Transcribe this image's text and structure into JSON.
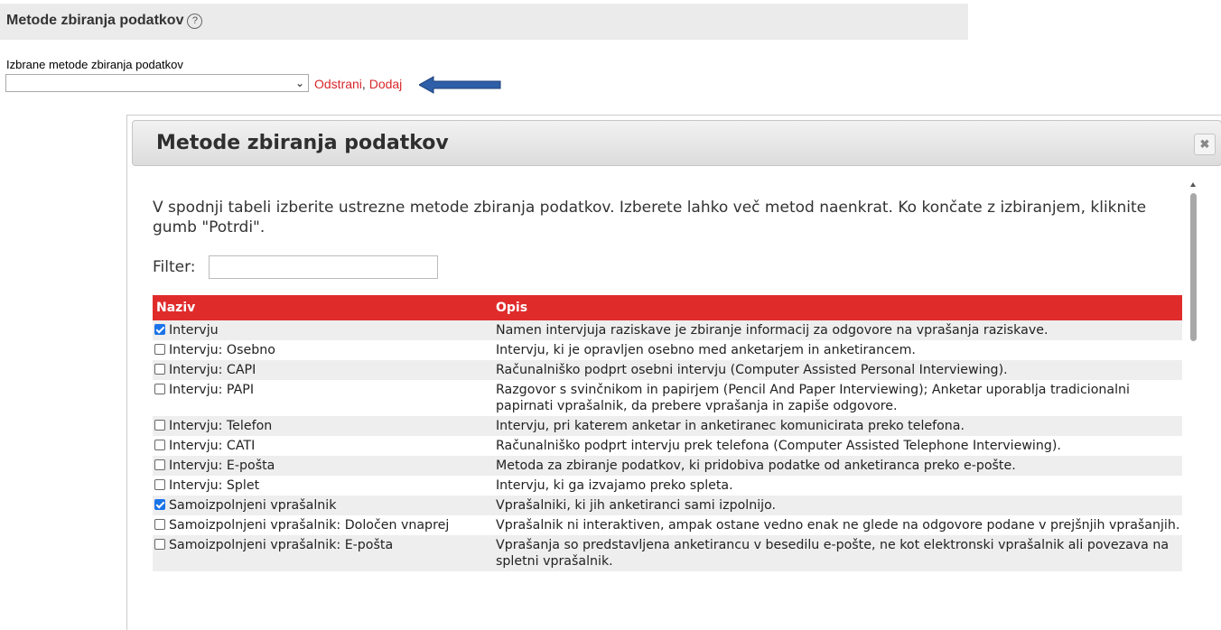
{
  "section": {
    "title": "Metode zbiranja podatkov",
    "help_icon": "?",
    "field_label": "Izbrane metode zbiranja podatkov",
    "select_value": "",
    "remove_link": "Odstrani",
    "separator": ",",
    "add_link": "Dodaj",
    "arrow_color": "#2e5fa8"
  },
  "dialog": {
    "title": "Metode zbiranja podatkov",
    "close_icon": "✖",
    "intro": "V spodnji tabeli izberite ustrezne metode zbiranja podatkov. Izberete lahko več metod naenkrat. Ko končate z izbiranjem, kliknite gumb \"Potrdi\".",
    "filter_label": "Filter:",
    "filter_value": "",
    "header_color": "#e02b2b",
    "table": {
      "headers": [
        "Naziv",
        "Opis"
      ],
      "rows": [
        {
          "name": "Intervju",
          "checked": true,
          "desc": "Namen intervjuja raziskave je zbiranje informacij za odgovore na vprašanja raziskave."
        },
        {
          "name": "Intervju: Osebno",
          "checked": false,
          "desc": "Intervju, ki je opravljen osebno med anketarjem in anketirancem."
        },
        {
          "name": "Intervju: CAPI",
          "checked": false,
          "desc": "Računalniško podprt osebni intervju (Computer Assisted Personal Interviewing)."
        },
        {
          "name": "Intervju: PAPI",
          "checked": false,
          "desc": "Razgovor s svinčnikom in papirjem (Pencil And Paper Interviewing); Anketar uporablja tradicionalni papirnati vprašalnik, da prebere vprašanja in zapiše odgovore."
        },
        {
          "name": "Intervju: Telefon",
          "checked": false,
          "desc": "Intervju, pri katerem anketar in anketiranec komunicirata preko telefona."
        },
        {
          "name": "Intervju: CATI",
          "checked": false,
          "desc": "Računalniško podprt intervju prek telefona (Computer Assisted Telephone Interviewing)."
        },
        {
          "name": "Intervju: E-pošta",
          "checked": false,
          "desc": "Metoda za zbiranje podatkov, ki pridobiva podatke od anketiranca preko e-pošte."
        },
        {
          "name": "Intervju: Splet",
          "checked": false,
          "desc": "Intervju, ki ga izvajamo preko spleta."
        },
        {
          "name": "Samoizpolnjeni vprašalnik",
          "checked": true,
          "desc": "Vprašalniki, ki jih anketiranci sami izpolnijo."
        },
        {
          "name": "Samoizpolnjeni vprašalnik: Določen vnaprej",
          "checked": false,
          "desc": "Vprašalnik ni interaktiven, ampak ostane vedno enak ne glede na odgovore podane v prejšnjih vprašanjih."
        },
        {
          "name": "Samoizpolnjeni vprašalnik: E-pošta",
          "checked": false,
          "desc": "Vprašanja so predstavljena anketirancu v besedilu e-pošte, ne kot elektronski vprašalnik ali povezava na spletni vprašalnik."
        }
      ]
    }
  }
}
